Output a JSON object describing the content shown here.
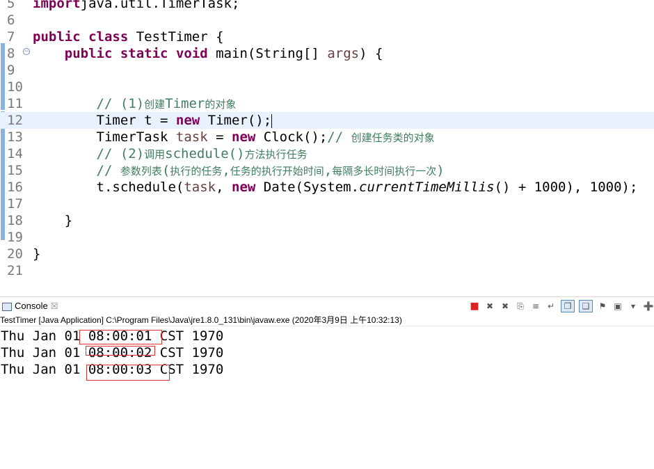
{
  "editor": {
    "lines": [
      {
        "num": "5",
        "tokens": [
          [
            "kw",
            "import"
          ],
          [
            "",
            "java.util.TimerTask;"
          ]
        ]
      },
      {
        "num": "6",
        "tokens": []
      },
      {
        "num": "7",
        "tokens": [
          [
            "kw",
            "public"
          ],
          [
            "",
            " "
          ],
          [
            "kw",
            "class"
          ],
          [
            "",
            " TestTimer {"
          ]
        ]
      },
      {
        "num": "8",
        "fold": "⊝",
        "tokens": [
          [
            "",
            "    "
          ],
          [
            "kw",
            "public"
          ],
          [
            "",
            " "
          ],
          [
            "kw",
            "static"
          ],
          [
            "",
            " "
          ],
          [
            "kw",
            "void"
          ],
          [
            "",
            " main(String[] "
          ],
          [
            "var",
            "args"
          ],
          [
            "",
            ") {"
          ]
        ]
      },
      {
        "num": "9",
        "tokens": []
      },
      {
        "num": "10",
        "tokens": []
      },
      {
        "num": "11",
        "tokens": [
          [
            "",
            "        "
          ],
          [
            "cm",
            "// (1)"
          ],
          [
            "cmcjk",
            "创建"
          ],
          [
            "cm",
            "Timer"
          ],
          [
            "cmcjk",
            "的对象"
          ]
        ]
      },
      {
        "num": "12",
        "current": true,
        "tokens": [
          [
            "",
            "        Timer t = "
          ],
          [
            "kw",
            "new"
          ],
          [
            "",
            " Timer();"
          ],
          [
            "caret",
            ""
          ]
        ]
      },
      {
        "num": "13",
        "tokens": [
          [
            "",
            "        TimerTask "
          ],
          [
            "var",
            "task"
          ],
          [
            "",
            " = "
          ],
          [
            "kw",
            "new"
          ],
          [
            "",
            " Clock();"
          ],
          [
            "cm",
            "// "
          ],
          [
            "cmcjk",
            "创建任务类的对象"
          ]
        ]
      },
      {
        "num": "14",
        "tokens": [
          [
            "",
            "        "
          ],
          [
            "cm",
            "// (2)"
          ],
          [
            "cmcjk",
            "调用"
          ],
          [
            "cm",
            "schedule()"
          ],
          [
            "cmcjk",
            "方法执行任务"
          ]
        ]
      },
      {
        "num": "15",
        "tokens": [
          [
            "",
            "        "
          ],
          [
            "cm",
            "// "
          ],
          [
            "cmcjk",
            "参数列表"
          ],
          [
            "cm",
            "("
          ],
          [
            "cmcjk",
            "执行的任务"
          ],
          [
            "cm",
            ","
          ],
          [
            "cmcjk",
            "任务的执行开始时间"
          ],
          [
            "cm",
            ","
          ],
          [
            "cmcjk",
            "每隔多长时间执行一次"
          ],
          [
            "cm",
            ")"
          ]
        ]
      },
      {
        "num": "16",
        "tokens": [
          [
            "",
            "        t.schedule("
          ],
          [
            "var",
            "task"
          ],
          [
            "",
            ", "
          ],
          [
            "kw",
            "new"
          ],
          [
            "",
            " Date(System."
          ],
          [
            "it",
            "currentTimeMillis"
          ],
          [
            "",
            "() + 1000), 1000);"
          ]
        ]
      },
      {
        "num": "17",
        "tokens": []
      },
      {
        "num": "18",
        "tokens": [
          [
            "",
            "    }"
          ]
        ]
      },
      {
        "num": "19",
        "tokens": []
      },
      {
        "num": "20",
        "tokens": [
          [
            "",
            "}"
          ]
        ]
      },
      {
        "num": "21",
        "tokens": []
      }
    ]
  },
  "console": {
    "tab_label": "Console",
    "tab_close": "☒",
    "status": "TestTimer [Java Application] C:\\Program Files\\Java\\jre1.8.0_131\\bin\\javaw.exe (2020年3月9日 上午10:32:13)",
    "output": [
      "Thu Jan 01 08:00:01 CST 1970",
      "Thu Jan 01 08:00:02 CST 1970",
      "Thu Jan 01 08:00:03 CST 1970"
    ],
    "toolbar": [
      {
        "name": "terminate-icon",
        "glyph": "■"
      },
      {
        "name": "remove-launch-icon",
        "glyph": "✖"
      },
      {
        "name": "remove-all-terminated-icon",
        "glyph": "✖"
      },
      {
        "name": "clear-console-icon",
        "glyph": "⎘"
      },
      {
        "name": "scroll-lock-icon",
        "glyph": "≡"
      },
      {
        "name": "word-wrap-icon",
        "glyph": "↵"
      },
      {
        "name": "show-on-stdout-icon",
        "glyph": "❐"
      },
      {
        "name": "show-on-stderr-icon",
        "glyph": "❑"
      },
      {
        "name": "pin-console-icon",
        "glyph": "⚑"
      },
      {
        "name": "display-console-icon",
        "glyph": "▣"
      },
      {
        "name": "dropdown-icon",
        "glyph": "▾"
      },
      {
        "name": "open-console-icon",
        "glyph": "➕"
      }
    ]
  },
  "colors": {
    "keyword": "#7f0055",
    "comment": "#3f7f5f",
    "highlight_box": "#e03030",
    "current_line": "#e8f2fe"
  }
}
